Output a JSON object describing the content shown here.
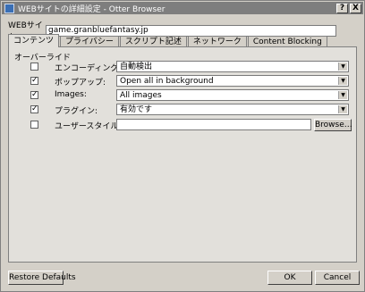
{
  "window": {
    "title": "WEBサイトの詳細設定 - Otter Browser"
  },
  "titlebar": {
    "help_label": "?",
    "close_label": "X"
  },
  "site": {
    "label": "WEBサイト:",
    "value": "game.granbluefantasy.jp"
  },
  "tabs": [
    {
      "label": "コンテンツ",
      "active": true
    },
    {
      "label": "プライバシー",
      "active": false
    },
    {
      "label": "スクリプト記述",
      "active": false
    },
    {
      "label": "ネットワーク",
      "active": false
    },
    {
      "label": "Content Blocking",
      "active": false
    }
  ],
  "overrides": {
    "section_label": "オーバーライド",
    "rows": [
      {
        "label": "エンコーディング:",
        "checked": false,
        "value": "自動検出"
      },
      {
        "label": "ポップアップ:",
        "checked": true,
        "value": "Open all in background"
      },
      {
        "label": "Images:",
        "checked": true,
        "value": "All images"
      },
      {
        "label": "プラグイン:",
        "checked": true,
        "value": "有効です"
      }
    ],
    "stylesheet": {
      "label": "ユーザースタイルシート:",
      "checked": false,
      "value": "",
      "browse_label": "Browse…"
    }
  },
  "footer": {
    "restore_label": "Restore Defaults",
    "ok_label": "OK",
    "cancel_label": "Cancel"
  },
  "icons": {
    "app": "otter-browser-icon",
    "help": "help-icon",
    "close": "close-icon",
    "dropdown": "chevron-down-icon",
    "check": "checkmark-icon"
  }
}
